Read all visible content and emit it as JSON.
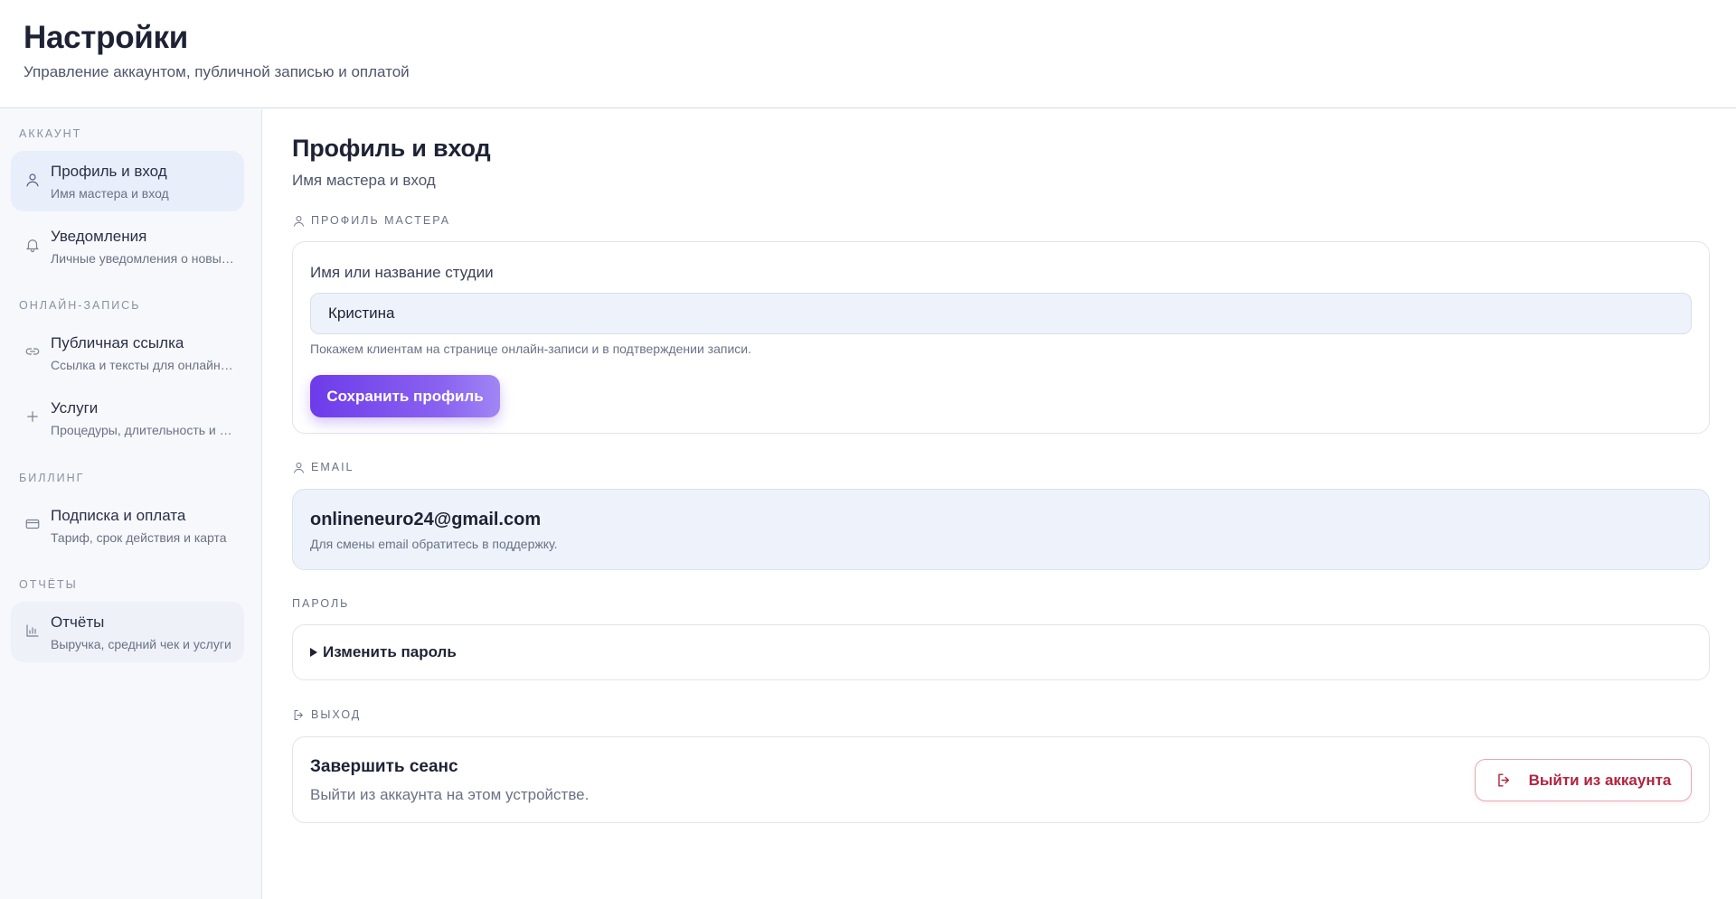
{
  "header": {
    "title": "Настройки",
    "subtitle": "Управление аккаунтом, публичной записью и оплатой"
  },
  "sidebar": {
    "groups": [
      {
        "title": "Аккаунт"
      },
      {
        "title": "Онлайн-запись"
      },
      {
        "title": "Биллинг"
      },
      {
        "title": "Отчёты"
      }
    ],
    "items": [
      {
        "label": "Профиль и вход",
        "desc": "Имя мастера и вход",
        "icon": "user-icon",
        "active": true
      },
      {
        "label": "Уведомления",
        "desc": "Личные уведомления о новых записях",
        "icon": "bell-icon"
      },
      {
        "label": "Публичная ссылка",
        "desc": "Ссылка и тексты для онлайн-записи",
        "icon": "link-icon"
      },
      {
        "label": "Услуги",
        "desc": "Процедуры, длительность и цены",
        "icon": "plus-icon"
      },
      {
        "label": "Подписка и оплата",
        "desc": "Тариф, срок действия и карта",
        "icon": "card-icon"
      },
      {
        "label": "Отчёты",
        "desc": "Выручка, средний чек и услуги",
        "icon": "chart-icon"
      }
    ]
  },
  "main": {
    "title": "Профиль и вход",
    "subtitle": "Имя мастера и вход",
    "profile": {
      "section_label": "Профиль мастера",
      "field_label": "Имя или название студии",
      "value": "Кристина",
      "hint": "Покажем клиентам на странице онлайн-записи и в подтверждении записи.",
      "save_label": "Сохранить профиль"
    },
    "email": {
      "section_label": "Email",
      "value": "onlineneuro24@gmail.com",
      "note": "Для смены email обратитесь в поддержку."
    },
    "password": {
      "section_label": "Пароль",
      "summary": "Изменить пароль"
    },
    "logout": {
      "section_label": "Выход",
      "title": "Завершить сеанс",
      "desc": "Выйти из аккаунта на этом устройстве.",
      "button_label": "Выйти из аккаунта"
    }
  },
  "colors": {
    "accent": "#6d3bea",
    "danger": "#b0243f",
    "sidebar_bg": "#f7f8fb",
    "active_item_bg": "#e9eefb"
  }
}
